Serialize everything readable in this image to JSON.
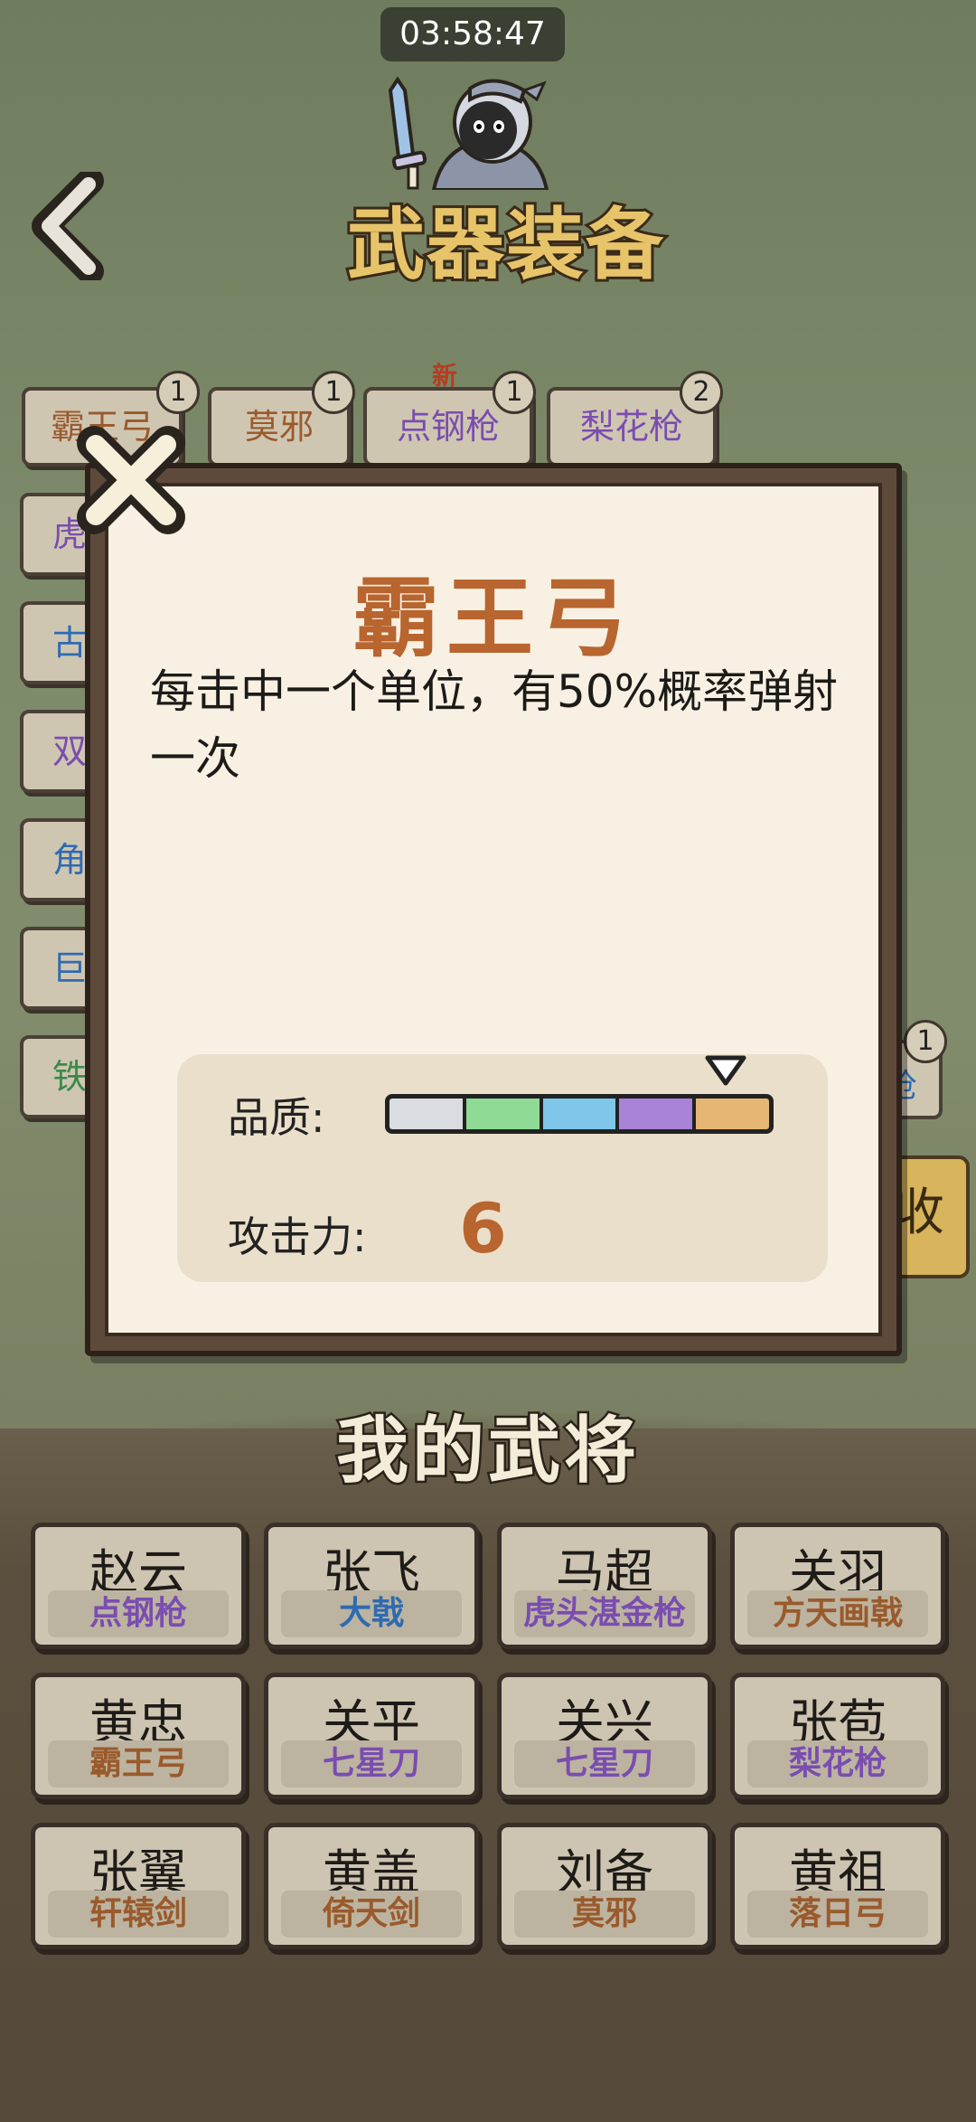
{
  "status": {
    "time": "03:58:47"
  },
  "header": {
    "title": "武器装备"
  },
  "weapon_tabs": [
    {
      "label": "霸王弓",
      "count": "1",
      "color": "#9a5a2c"
    },
    {
      "label": "莫邪",
      "count": "1",
      "color": "#9a5a2c"
    },
    {
      "label": "点钢枪",
      "count": "1",
      "color": "#7a4db0",
      "tag": "新"
    },
    {
      "label": "梨花枪",
      "count": "2",
      "color": "#7a4db0"
    }
  ],
  "side_tabs": [
    {
      "label": "虎",
      "color": "#7a4db0"
    },
    {
      "label": "古",
      "color": "#2f6bb0"
    },
    {
      "label": "双",
      "color": "#7a4db0"
    },
    {
      "label": "角",
      "color": "#2f6bb0"
    },
    {
      "label": "巨",
      "color": "#2f6bb0"
    },
    {
      "label": "铁",
      "color": "#3b8a4a"
    }
  ],
  "right_peek": {
    "count": "1",
    "text": "枪"
  },
  "collect_button": {
    "label": "收"
  },
  "modal": {
    "name": "霸王弓",
    "description": "每击中一个单位，有50%概率弹射一次",
    "quality_label": "品质:",
    "quality_level": 5,
    "quality_colors": [
      "#d9dce0",
      "#8fdb95",
      "#7ec6ea",
      "#a883d8",
      "#e6b774"
    ],
    "attack_label": "攻击力:",
    "attack_value": "6"
  },
  "heroes_section": {
    "title": "我的武将"
  },
  "heroes": [
    {
      "name": "赵云",
      "weapon": "点钢枪",
      "color": "#7a4db0"
    },
    {
      "name": "张飞",
      "weapon": "大戟",
      "color": "#2f6bb0"
    },
    {
      "name": "马超",
      "weapon": "虎头湛金枪",
      "color": "#7a4db0"
    },
    {
      "name": "关羽",
      "weapon": "方天画戟",
      "color": "#9a5a2c"
    },
    {
      "name": "黄忠",
      "weapon": "霸王弓",
      "color": "#9a5a2c"
    },
    {
      "name": "关平",
      "weapon": "七星刀",
      "color": "#7a4db0"
    },
    {
      "name": "关兴",
      "weapon": "七星刀",
      "color": "#7a4db0"
    },
    {
      "name": "张苞",
      "weapon": "梨花枪",
      "color": "#7a4db0"
    },
    {
      "name": "张翼",
      "weapon": "轩辕剑",
      "color": "#9a5a2c"
    },
    {
      "name": "黄盖",
      "weapon": "倚天剑",
      "color": "#9a5a2c"
    },
    {
      "name": "刘备",
      "weapon": "莫邪",
      "color": "#9a5a2c"
    },
    {
      "name": "黄祖",
      "weapon": "落日弓",
      "color": "#9a5a2c"
    }
  ]
}
